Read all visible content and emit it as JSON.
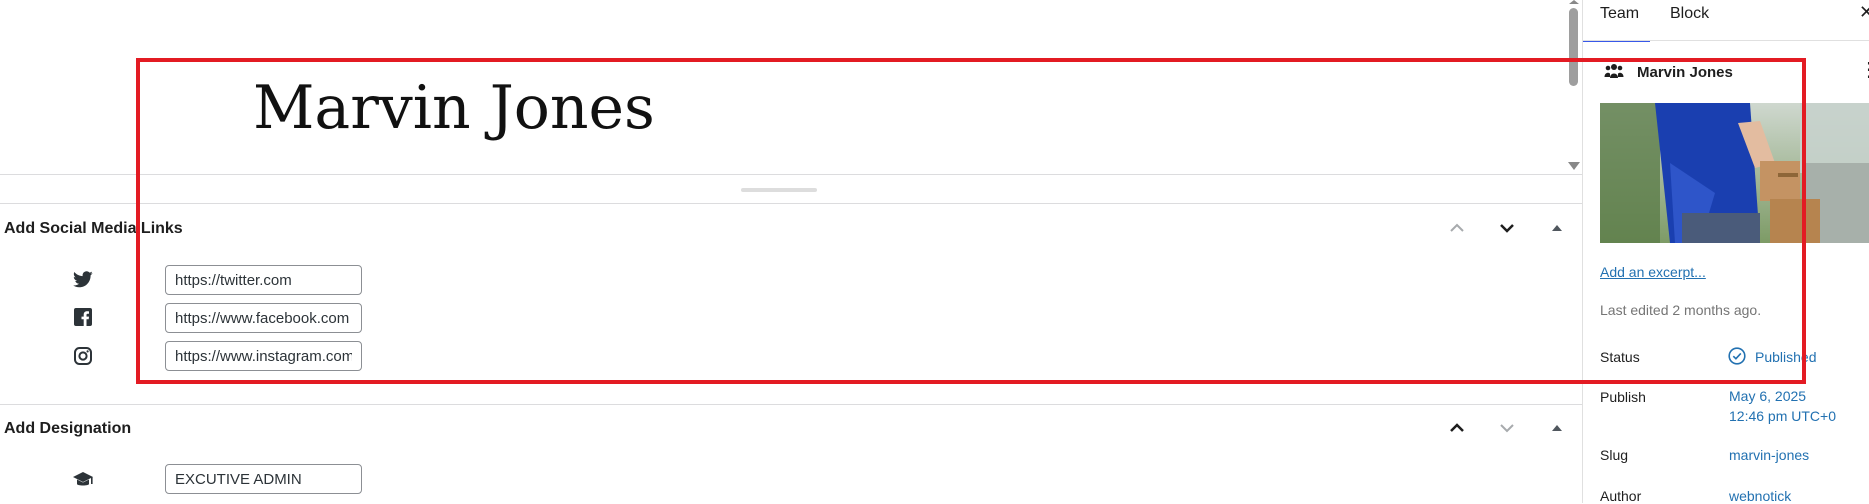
{
  "editor": {
    "title": "Marvin Jones"
  },
  "social_panel": {
    "heading": "Add Social Media Links",
    "links": [
      {
        "icon": "twitter-icon",
        "value": "https://twitter.com"
      },
      {
        "icon": "facebook-icon",
        "value": "https://www.facebook.com"
      },
      {
        "icon": "instagram-icon",
        "value": "https://www.instagram.com"
      }
    ]
  },
  "designation_panel": {
    "heading": "Add Designation",
    "icon": "graduation-cap-icon",
    "value": "EXCUTIVE ADMIN"
  },
  "sidebar": {
    "tabs": [
      "Team",
      "Block"
    ],
    "active_tab": "Team",
    "post_type_icon": "team-icon",
    "post_title": "Marvin Jones",
    "excerpt_link": "Add an excerpt...",
    "last_edited": "Last edited 2 months ago.",
    "status_label": "Status",
    "status_value": "Published",
    "publish_label": "Publish",
    "publish_date": "May 6, 2025",
    "publish_time": "12:46 pm UTC+0",
    "slug_label": "Slug",
    "slug_value": "marvin-jones",
    "author_label": "Author",
    "author_value": "webnotick"
  },
  "colors": {
    "accent": "#3858e9",
    "link": "#2271b1",
    "highlight": "#e31b23"
  }
}
